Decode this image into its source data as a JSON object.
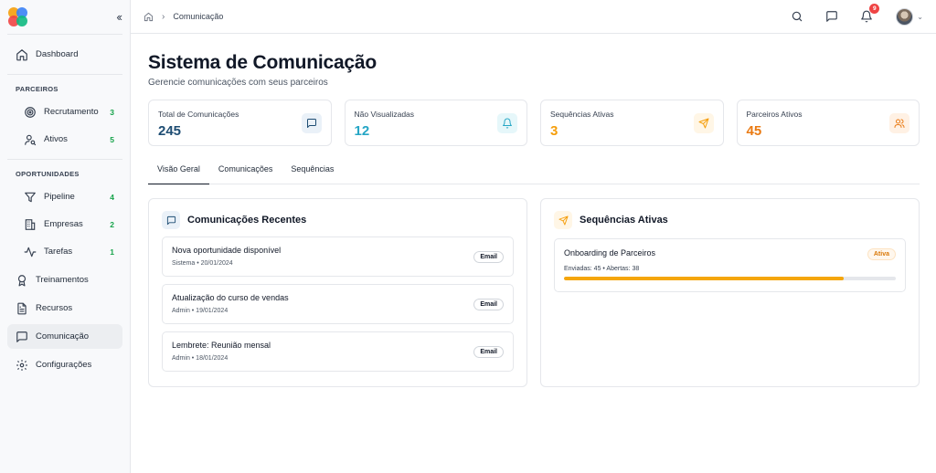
{
  "sidebar": {
    "collapse_icon": "chevrons-left-icon",
    "items": {
      "dashboard": "Dashboard",
      "recrutamento": "Recrutamento",
      "recrutamento_count": "3",
      "ativos": "Ativos",
      "ativos_count": "5",
      "pipeline": "Pipeline",
      "pipeline_count": "4",
      "empresas": "Empresas",
      "empresas_count": "2",
      "tarefas": "Tarefas",
      "tarefas_count": "1",
      "treinamentos": "Treinamentos",
      "recursos": "Recursos",
      "comunicacao": "Comunicação",
      "configuracoes": "Configurações"
    },
    "sections": {
      "parceiros": "PARCEIROS",
      "oportunidades": "OPORTUNIDADES"
    }
  },
  "header": {
    "breadcrumb": "Comunicação",
    "notification_count": "9"
  },
  "page": {
    "title": "Sistema de Comunicação",
    "subtitle": "Gerencie comunicações com seus parceiros"
  },
  "stats": [
    {
      "label": "Total de Comunicações",
      "value": "245",
      "color": "#1e4d73",
      "icon": "message-square-icon",
      "icon_bg": "#eaf1f8"
    },
    {
      "label": "Não Visualizadas",
      "value": "12",
      "color": "#26a6c5",
      "icon": "bell-icon",
      "icon_bg": "#e6f7fa"
    },
    {
      "label": "Sequências Ativas",
      "value": "3",
      "color": "#f59e0b",
      "icon": "send-icon",
      "icon_bg": "#fff6e6"
    },
    {
      "label": "Parceiros Ativos",
      "value": "45",
      "color": "#ea7a12",
      "icon": "users-icon",
      "icon_bg": "#fff1e4"
    }
  ],
  "tabs": [
    "Visão Geral",
    "Comunicações",
    "Sequências"
  ],
  "recent": {
    "title": "Comunicações Recentes",
    "items": [
      {
        "title": "Nova oportunidade disponível",
        "meta": "Sistema • 20/01/2024",
        "tag": "Email"
      },
      {
        "title": "Atualização do curso de vendas",
        "meta": "Admin • 19/01/2024",
        "tag": "Email"
      },
      {
        "title": "Lembrete: Reunião mensal",
        "meta": "Admin • 18/01/2024",
        "tag": "Email"
      }
    ]
  },
  "sequences": {
    "title": "Sequências Ativas",
    "items": [
      {
        "title": "Onboarding de Parceiros",
        "status": "Ativa",
        "meta": "Enviadas: 45 • Abertas: 38",
        "progress": 0.844
      }
    ]
  },
  "colors": {
    "accent_orange": "#f5a60b",
    "count_green": "#16a34a",
    "notification_red": "#ef4444"
  }
}
